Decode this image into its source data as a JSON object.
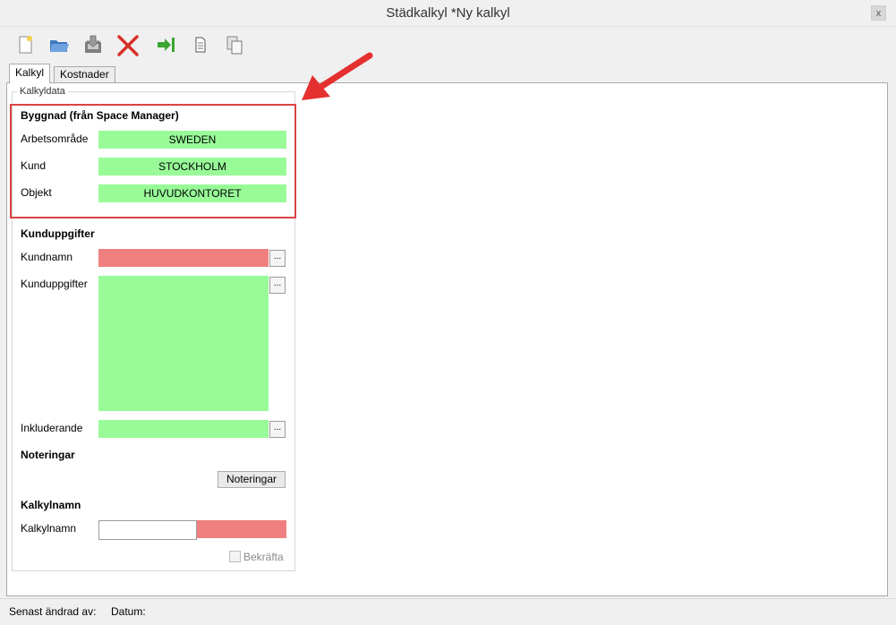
{
  "window": {
    "title": "Städkalkyl *Ny kalkyl",
    "close_label": "x"
  },
  "toolbar": {
    "buttons": [
      {
        "name": "new-document-icon"
      },
      {
        "name": "open-folder-icon"
      },
      {
        "name": "save-icon"
      },
      {
        "name": "delete-icon"
      },
      {
        "name": "export-icon"
      },
      {
        "name": "page-icon"
      },
      {
        "name": "copy-icon"
      }
    ]
  },
  "tabs": [
    {
      "label": "Kalkyl",
      "active": true
    },
    {
      "label": "Kostnader",
      "active": false
    }
  ],
  "form": {
    "group_title": "Kalkyldata",
    "building": {
      "heading": "Byggnad (från Space Manager)",
      "arbetsomrade_label": "Arbetsområde",
      "arbetsomrade_value": "SWEDEN",
      "kund_label": "Kund",
      "kund_value": "STOCKHOLM",
      "objekt_label": "Objekt",
      "objekt_value": "HUVUDKONTORET"
    },
    "customer": {
      "heading": "Kunduppgifter",
      "kundnamn_label": "Kundnamn",
      "kunduppgifter_label": "Kunduppgifter",
      "inkluderande_label": "Inkluderande",
      "browse_label": "..."
    },
    "notes": {
      "heading": "Noteringar",
      "button_label": "Noteringar"
    },
    "calc_name": {
      "heading": "Kalkylnamn",
      "label": "Kalkylnamn",
      "value": "",
      "confirm_label": "Bekräfta"
    }
  },
  "status": {
    "changed_by_label": "Senast ändrad av:",
    "date_label": "Datum:"
  },
  "colors": {
    "valid": "#98fb98",
    "invalid": "#f08080",
    "highlight": "#d94444",
    "arrow": "#e53030"
  }
}
